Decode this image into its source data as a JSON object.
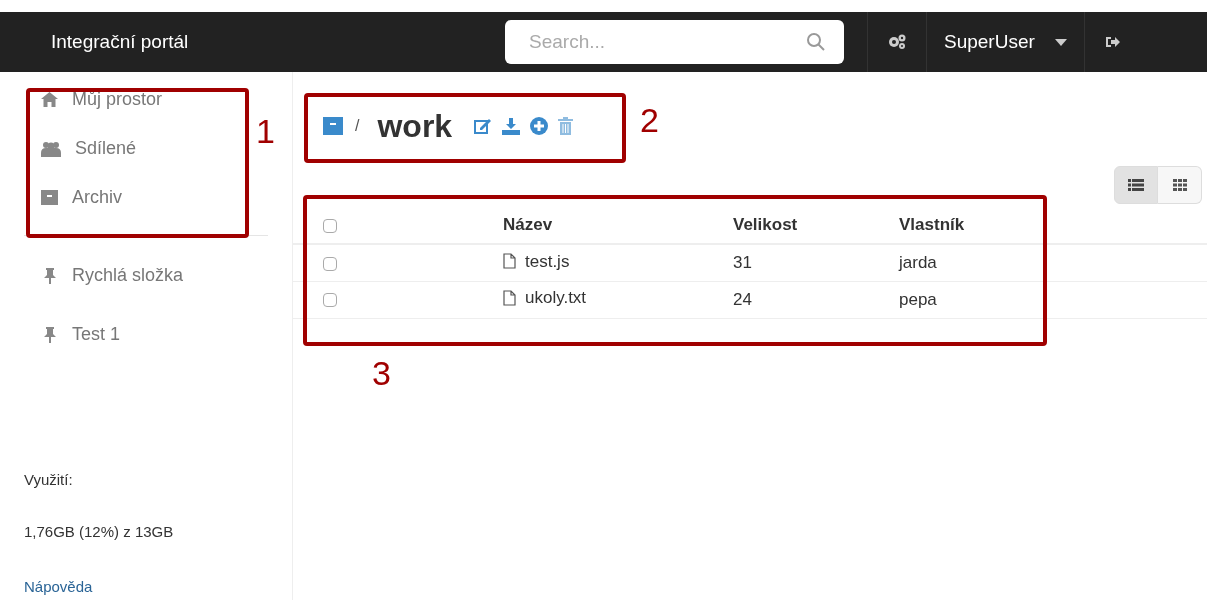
{
  "navbar": {
    "brand": "Integrační portál",
    "search": {
      "placeholder": "Search..."
    },
    "user": "SuperUser"
  },
  "sidebar": {
    "main_items": [
      {
        "kind": "home",
        "label": "Můj prostor"
      },
      {
        "kind": "users",
        "label": "Sdílené"
      },
      {
        "kind": "archive",
        "label": "Archiv"
      }
    ],
    "pinned_items": [
      {
        "label": "Rychlá složka"
      },
      {
        "label": "Test 1"
      }
    ],
    "usage_label": "Využití:",
    "usage_value": "1,76GB (12%) z 13GB",
    "help_link": "Nápověda"
  },
  "breadcrumb": {
    "separator": "/",
    "folder": "work"
  },
  "view_toggle": [
    {
      "kind": "list",
      "selected": true
    },
    {
      "kind": "grid",
      "selected": false
    }
  ],
  "table": {
    "select_all_checked": false,
    "columns": [
      "Název",
      "Velikost",
      "Vlastník"
    ],
    "rows": [
      {
        "checked": false,
        "name": "test.js",
        "size": "31",
        "owner": "jarda"
      },
      {
        "checked": false,
        "name": "ukoly.txt",
        "size": "24",
        "owner": "pepa"
      }
    ]
  },
  "annotations": [
    {
      "label": "1"
    },
    {
      "label": "2"
    },
    {
      "label": "3"
    }
  ]
}
